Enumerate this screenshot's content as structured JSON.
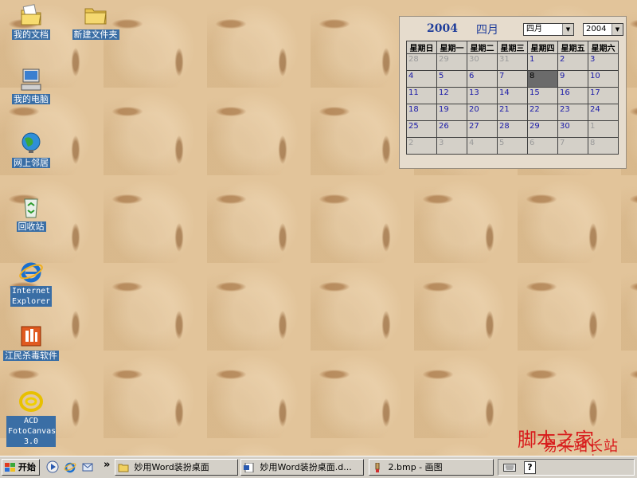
{
  "desktop": {
    "icons": [
      {
        "label": "我的文档",
        "icon": "my-documents-icon"
      },
      {
        "label": "新建文件夹",
        "icon": "folder-icon"
      },
      {
        "label": "我的电脑",
        "icon": "my-computer-icon"
      },
      {
        "label": "网上邻居",
        "icon": "network-places-icon"
      },
      {
        "label": "回收站",
        "icon": "recycle-bin-icon"
      },
      {
        "label": "Internet Explorer",
        "icon": "internet-explorer-icon"
      },
      {
        "label": "江民杀毒软件",
        "icon": "antivirus-icon"
      },
      {
        "label": "ACD FotoCanvas 3.0",
        "icon": "acd-fotocanvas-icon"
      }
    ]
  },
  "calendar": {
    "year_title": "2004",
    "month_title": "四月",
    "month_select": "四月",
    "year_select": "2004",
    "weekdays": [
      "星期日",
      "星期一",
      "星期二",
      "星期三",
      "星期四",
      "星期五",
      "星期六"
    ],
    "weeks": [
      [
        "28",
        "29",
        "30",
        "31",
        "1",
        "2",
        "3"
      ],
      [
        "4",
        "5",
        "6",
        "7",
        "8",
        "9",
        "10"
      ],
      [
        "11",
        "12",
        "13",
        "14",
        "15",
        "16",
        "17"
      ],
      [
        "18",
        "19",
        "20",
        "21",
        "22",
        "23",
        "24"
      ],
      [
        "25",
        "26",
        "27",
        "28",
        "29",
        "30",
        "1"
      ],
      [
        "2",
        "3",
        "4",
        "5",
        "6",
        "7",
        "8"
      ]
    ],
    "selected_day": "8"
  },
  "taskbar": {
    "start_label": "开始",
    "quicklaunch_more": "»",
    "tasks": [
      {
        "label": "妙用Word装扮桌面",
        "icon": "folder-icon"
      },
      {
        "label": "妙用Word装扮桌面.d...",
        "icon": "word-document-icon"
      },
      {
        "label": "2.bmp - 画图",
        "icon": "paint-icon"
      }
    ],
    "tray_help": "?"
  },
  "watermark": {
    "line1": "脚本之家",
    "line2": "易采站长站",
    "line3": "www.easck.com"
  },
  "colors": {
    "desktop_label_bg": "#3a6ea5",
    "calendar_title": "#1f3d9a",
    "calendar_day": "#1a1aa8",
    "watermark": "#d81c1c"
  }
}
